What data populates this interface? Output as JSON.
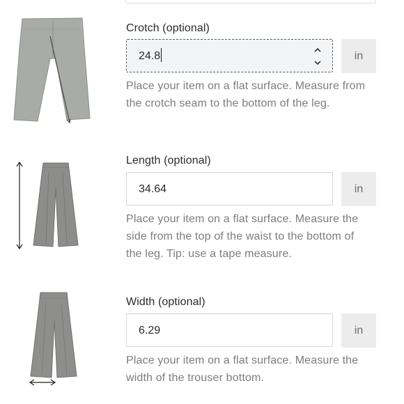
{
  "crotch": {
    "label": "Crotch (optional)",
    "value": "24.8",
    "unit": "in",
    "help": "Place your item on a flat surface. Measure from the crotch seam to the bottom of the leg."
  },
  "length": {
    "label": "Length (optional)",
    "value": "34.64",
    "unit": "in",
    "help": "Place your item on a flat surface. Measure the side from the top of the waist to the bottom of the leg. Tip: use a tape measure."
  },
  "width": {
    "label": "Width (optional)",
    "value": "6.29",
    "unit": "in",
    "help": "Place your item on a flat surface. Measure the width of the trouser bottom."
  },
  "icons": {
    "crotch_image": "trousers-crotch-diagram",
    "length_image": "trousers-length-diagram",
    "width_image": "trousers-width-diagram",
    "stepper": "number-stepper-icon"
  },
  "colors": {
    "unit_bg": "#ececec",
    "focused_input_bg": "#f3f4f6",
    "help_text": "#7d7d7d"
  }
}
